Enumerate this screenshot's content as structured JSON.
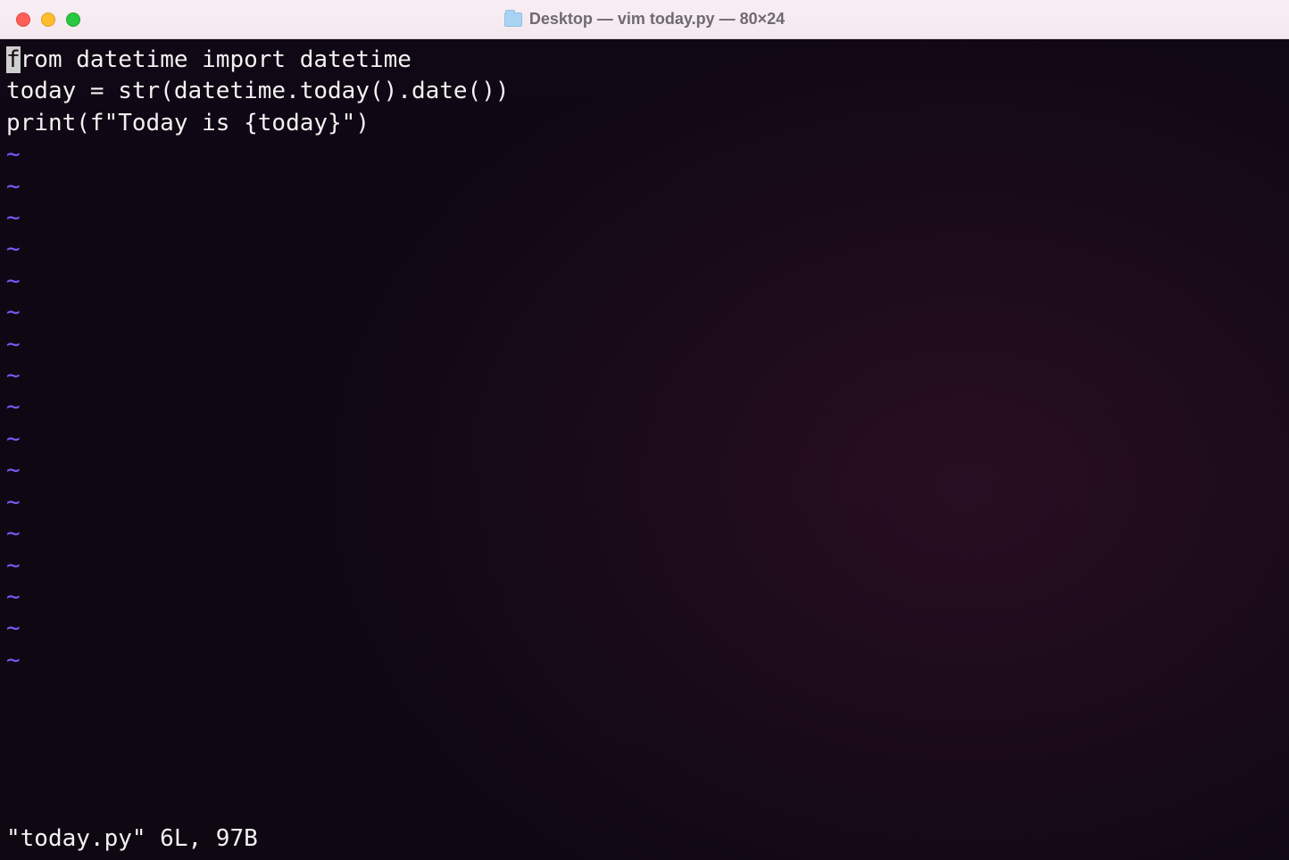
{
  "titlebar": {
    "title": "Desktop — vim today.py — 80×24"
  },
  "editor": {
    "cursor_char": "f",
    "line1_rest": "rom datetime import datetime",
    "line2": "",
    "line3": "today = str(datetime.today().date())",
    "line4": "",
    "line5": "print(f\"Today is {today}\")",
    "line6": "",
    "tilde": "~",
    "status": "\"today.py\" 6L, 97B"
  }
}
